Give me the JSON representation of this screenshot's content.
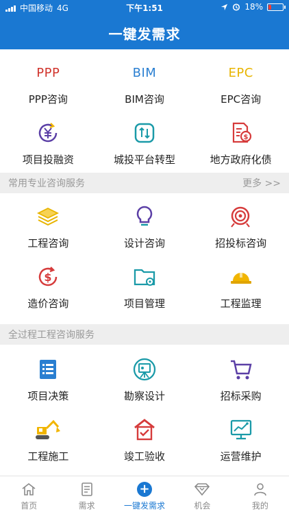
{
  "status_bar": {
    "carrier": "中国移动",
    "network": "4G",
    "time": "下午1:51",
    "battery_percent": "18%",
    "battery_level": 0.18
  },
  "header": {
    "title": "一键发需求"
  },
  "top_items": [
    {
      "logo": "PPP",
      "label": "PPP咨询",
      "color": "#d0342c"
    },
    {
      "logo": "BIM",
      "label": "BIM咨询",
      "color": "#2a7fd1"
    },
    {
      "logo": "EPC",
      "label": "EPC咨询",
      "color": "#e8b400"
    },
    {
      "icon": "yen-cycle-icon",
      "label": "项目投融资"
    },
    {
      "icon": "refresh-square-icon",
      "label": "城投平台转型"
    },
    {
      "icon": "document-dollar-icon",
      "label": "地方政府化债"
    }
  ],
  "section_common": {
    "title": "常用专业咨询服务",
    "more": "更多 >>"
  },
  "common_items": [
    {
      "icon": "layers-icon",
      "label": "工程咨询"
    },
    {
      "icon": "lightbulb-icon",
      "label": "设计咨询"
    },
    {
      "icon": "target-icon",
      "label": "招投标咨询"
    },
    {
      "icon": "dollar-cycle-icon",
      "label": "造价咨询"
    },
    {
      "icon": "folder-gear-icon",
      "label": "项目管理"
    },
    {
      "icon": "hard-hat-icon",
      "label": "工程监理"
    }
  ],
  "section_full": {
    "title": "全过程工程咨询服务"
  },
  "full_items": [
    {
      "icon": "list-doc-icon",
      "label": "项目决策"
    },
    {
      "icon": "survey-instrument-icon",
      "label": "勘察设计"
    },
    {
      "icon": "shopping-cart-icon",
      "label": "招标采购"
    },
    {
      "icon": "excavator-icon",
      "label": "工程施工"
    },
    {
      "icon": "house-check-icon",
      "label": "竣工验收"
    },
    {
      "icon": "monitor-chart-icon",
      "label": "运营维护"
    }
  ],
  "tabs": [
    {
      "label": "首页",
      "icon": "home-icon"
    },
    {
      "label": "需求",
      "icon": "document-icon"
    },
    {
      "label": "一键发需求",
      "icon": "plus-circle-icon",
      "active": true
    },
    {
      "label": "机会",
      "icon": "diamond-icon"
    },
    {
      "label": "我的",
      "icon": "user-icon"
    }
  ],
  "colors": {
    "brand_blue": "#1a78d2",
    "ppp_red": "#d0342c",
    "bim_blue": "#2a7fd1",
    "epc_yellow": "#e8b400",
    "purple": "#5b3fa6",
    "teal": "#1a9aa8",
    "red": "#d63b3b",
    "yellow": "#f1b500"
  }
}
